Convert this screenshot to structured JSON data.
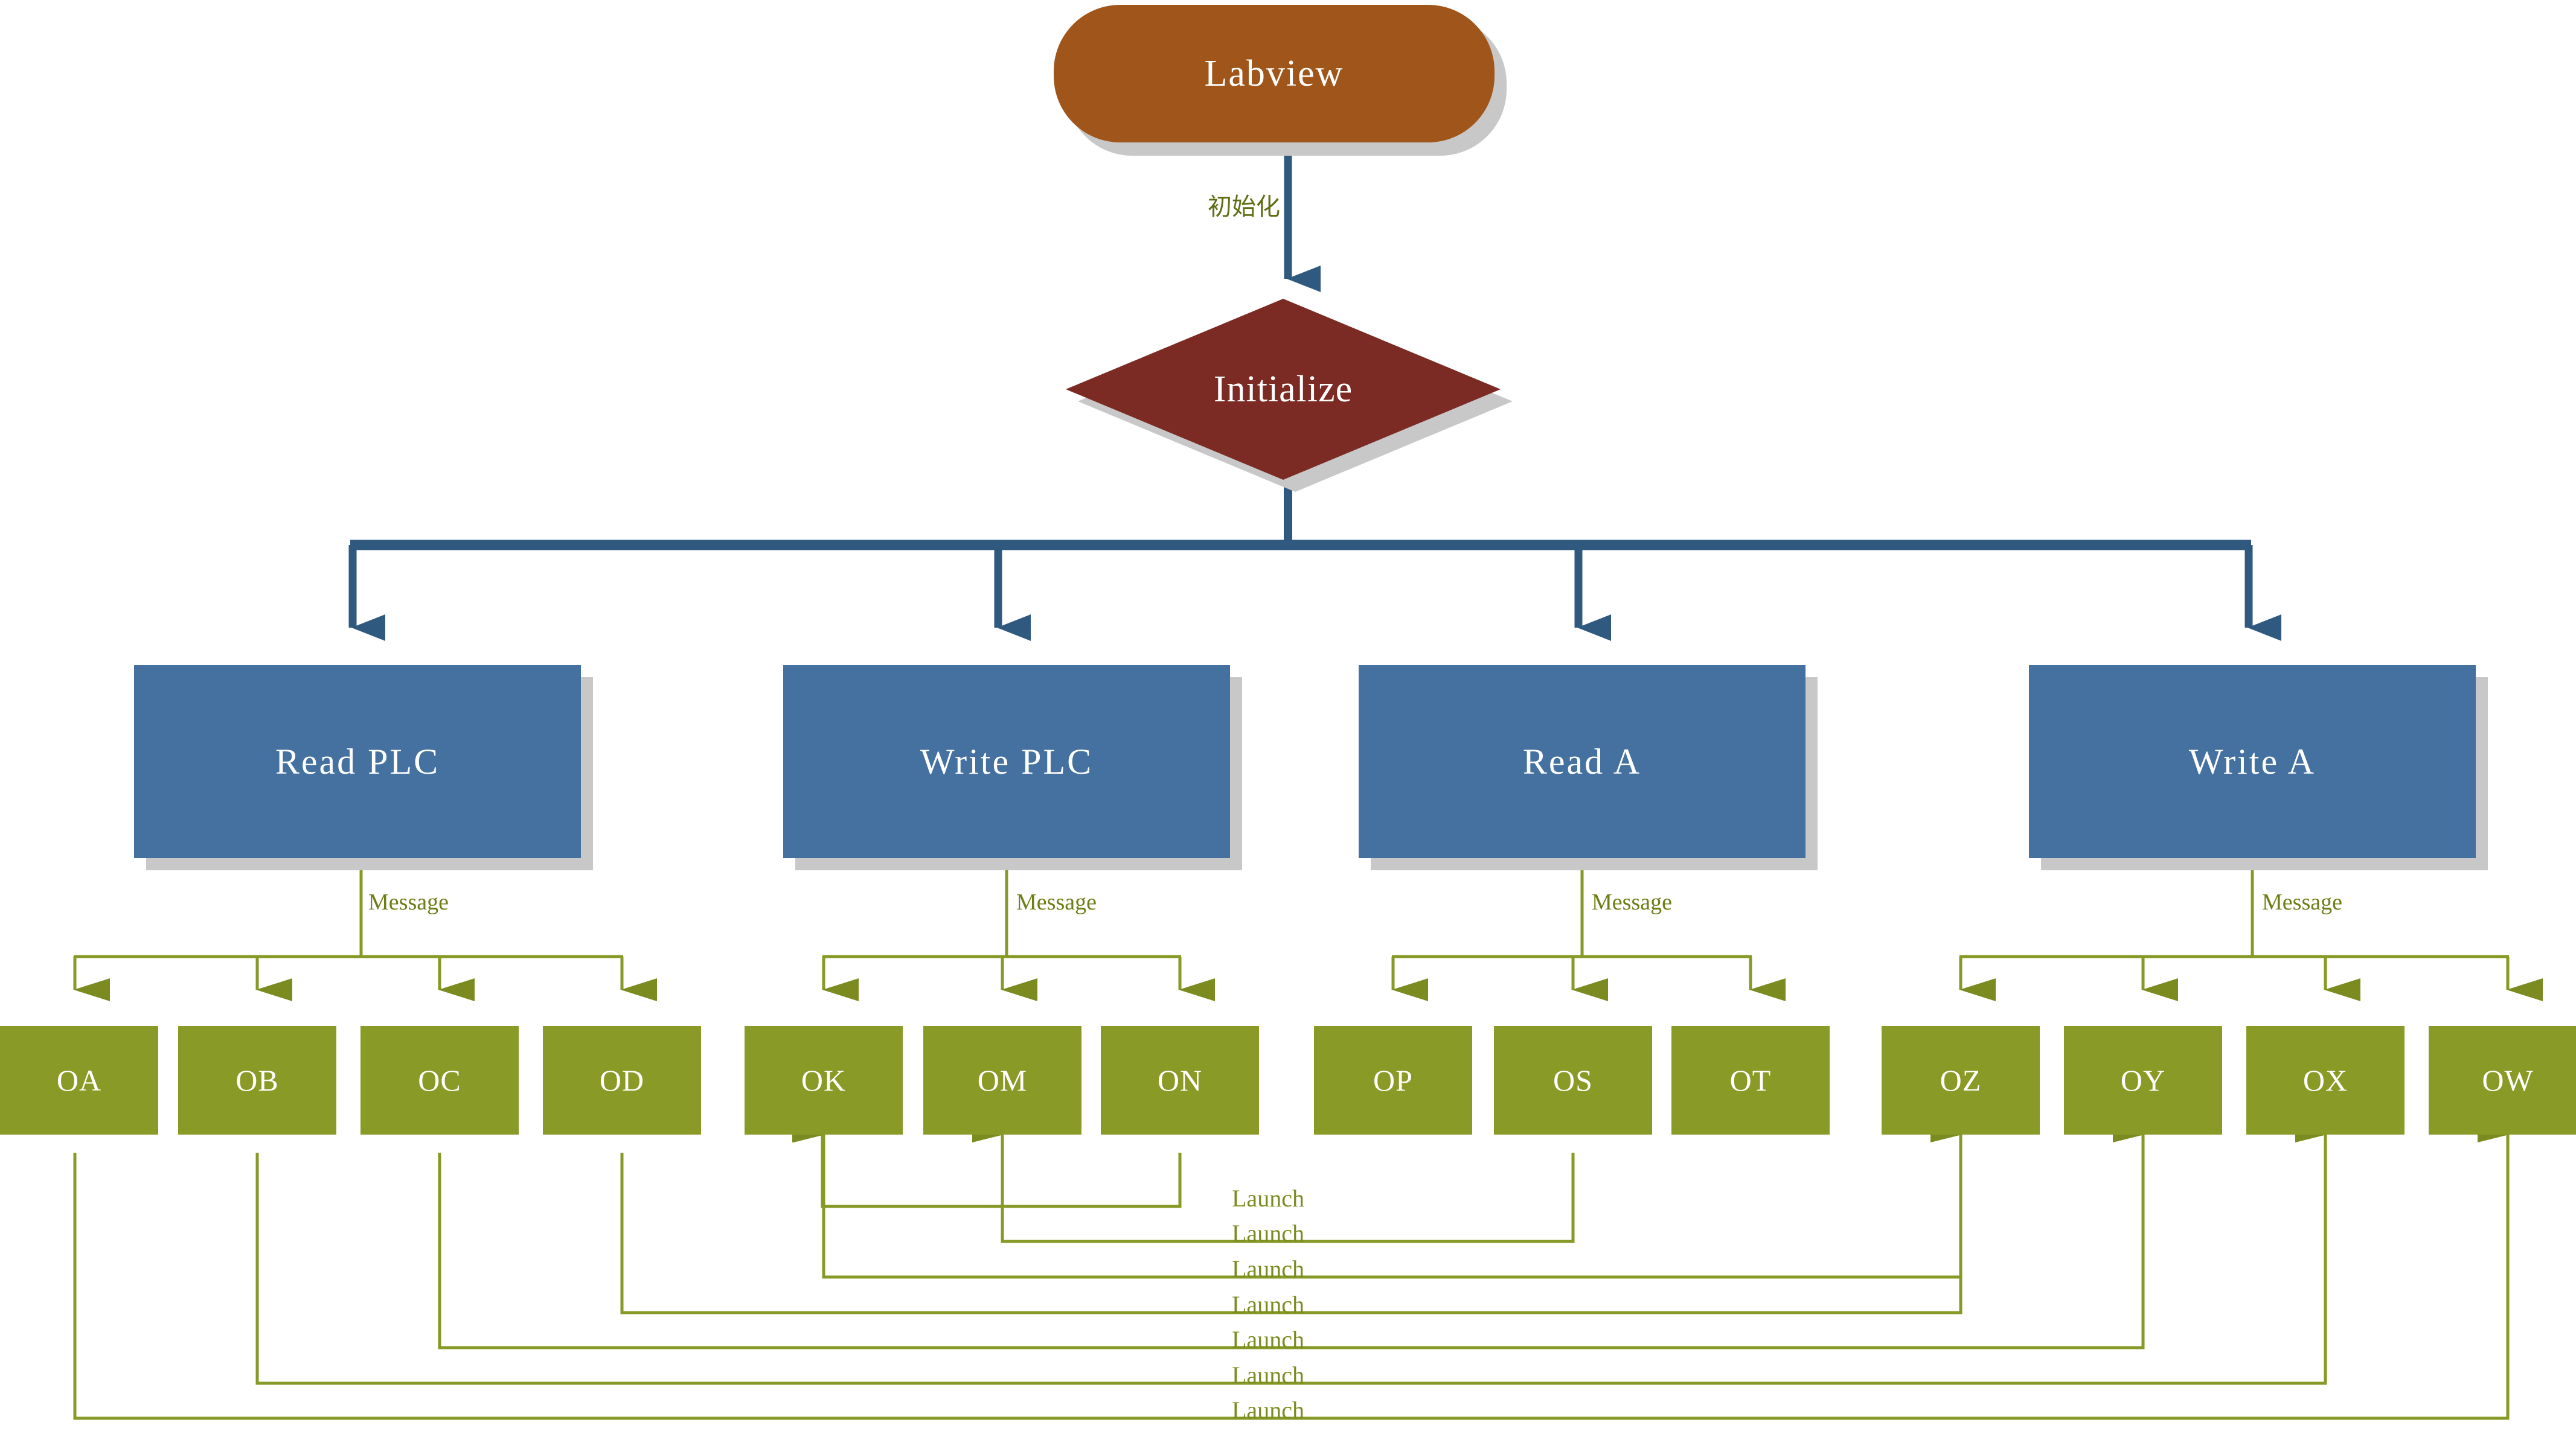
{
  "diagram": {
    "title_node": {
      "label": "Labview",
      "shape": "rounded-rectangle",
      "color": "#A0561B"
    },
    "decision_node": {
      "label": "Initialize",
      "shape": "diamond",
      "color": "#7B2B24"
    },
    "init_edge_label": "初始化",
    "process_nodes": [
      {
        "id": "read-plc",
        "label": "Read PLC",
        "color": "#44719F"
      },
      {
        "id": "write-plc",
        "label": "Write PLC",
        "color": "#44719F"
      },
      {
        "id": "read-a",
        "label": "Read A",
        "color": "#44719F"
      },
      {
        "id": "write-a",
        "label": "Write A",
        "color": "#44719F"
      }
    ],
    "message_labels": [
      "Message",
      "Message",
      "Message",
      "Message"
    ],
    "task_nodes": [
      {
        "id": "oa",
        "label": "OA",
        "color": "#899B26"
      },
      {
        "id": "ob",
        "label": "OB",
        "color": "#899B26"
      },
      {
        "id": "oc",
        "label": "OC",
        "color": "#899B26"
      },
      {
        "id": "od",
        "label": "OD",
        "color": "#899B26"
      },
      {
        "id": "ok",
        "label": "OK",
        "color": "#899B26"
      },
      {
        "id": "om",
        "label": "OM",
        "color": "#899B26"
      },
      {
        "id": "on",
        "label": "ON",
        "color": "#899B26"
      },
      {
        "id": "op",
        "label": "OP",
        "color": "#899B26"
      },
      {
        "id": "os",
        "label": "OS",
        "color": "#899B26"
      },
      {
        "id": "ot",
        "label": "OT",
        "color": "#899B26"
      },
      {
        "id": "oz",
        "label": "OZ",
        "color": "#899B26"
      },
      {
        "id": "oy",
        "label": "OY",
        "color": "#899B26"
      },
      {
        "id": "ox",
        "label": "OX",
        "color": "#899B26"
      },
      {
        "id": "ow",
        "label": "OW",
        "color": "#899B26"
      }
    ],
    "launch_labels": [
      "Launch",
      "Launch",
      "Launch",
      "Launch",
      "Launch",
      "Launch",
      "Launch"
    ],
    "colors": {
      "orange": "#A0561B",
      "dark_red": "#7B2B24",
      "blue": "#44719F",
      "green": "#899B26",
      "shadow": "#C8C8C8",
      "green_line": "#7B8B1F",
      "blue_line": "#30597F",
      "label_text": "#6E7D16"
    }
  }
}
